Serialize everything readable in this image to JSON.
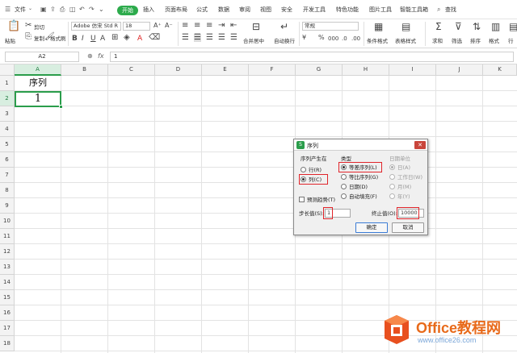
{
  "menu": {
    "file": "文件",
    "tabs": [
      "开始",
      "插入",
      "页面布局",
      "公式",
      "数据",
      "审阅",
      "视图",
      "安全",
      "开发工具",
      "特色功能",
      "图片工具",
      "智能工具箱"
    ],
    "search": "查找"
  },
  "ribbon": {
    "paste": "粘贴",
    "cut": "剪切",
    "copy": "复制",
    "format_painter": "格式刷",
    "font_name": "Adobe 仿宋 Std R",
    "font_size": "18",
    "number_format": "常规",
    "merge_center": "合并居中",
    "wrap_text": "自动换行",
    "conditional_format": "条件格式",
    "table_style": "表格样式",
    "sum": "求和",
    "filter": "筛选",
    "sort": "排序",
    "format": "格式",
    "rows_cols": "行"
  },
  "formula_bar": {
    "cell_ref": "A2",
    "fx": "fx",
    "value": "1"
  },
  "grid": {
    "columns": [
      "A",
      "B",
      "C",
      "D",
      "E",
      "F",
      "G",
      "H",
      "I",
      "J",
      "K"
    ],
    "rows": [
      "1",
      "2",
      "3",
      "4",
      "5",
      "6",
      "7",
      "8",
      "9",
      "10",
      "11",
      "12",
      "13",
      "14",
      "15",
      "16",
      "17",
      "18"
    ],
    "a1": "序列",
    "a2": "1"
  },
  "dialog": {
    "title": "序列",
    "series_in": {
      "title": "序列产生在",
      "options": [
        "行(R)",
        "列(C)"
      ],
      "selected": "列(C)"
    },
    "type": {
      "title": "类型",
      "options": [
        "等差序列(L)",
        "等比序列(G)",
        "日期(D)",
        "自动填充(F)"
      ],
      "selected": "等差序列(L)"
    },
    "date_unit": {
      "title": "日期单位",
      "options": [
        "日(A)",
        "工作日(W)",
        "月(M)",
        "年(Y)"
      ],
      "selected": "日(A)"
    },
    "trend": "预测趋势(T)",
    "step_label": "步长值(S):",
    "step_value": "1",
    "stop_label": "终止值(O):",
    "stop_value": "10000",
    "ok": "确定",
    "cancel": "取消"
  },
  "watermark": {
    "brand": "Office教程网",
    "url": "www.office26.com"
  },
  "colors": {
    "accent_green": "#2a9d4b",
    "highlight_red": "#e0242a",
    "watermark_orange": "#e86a1a"
  }
}
